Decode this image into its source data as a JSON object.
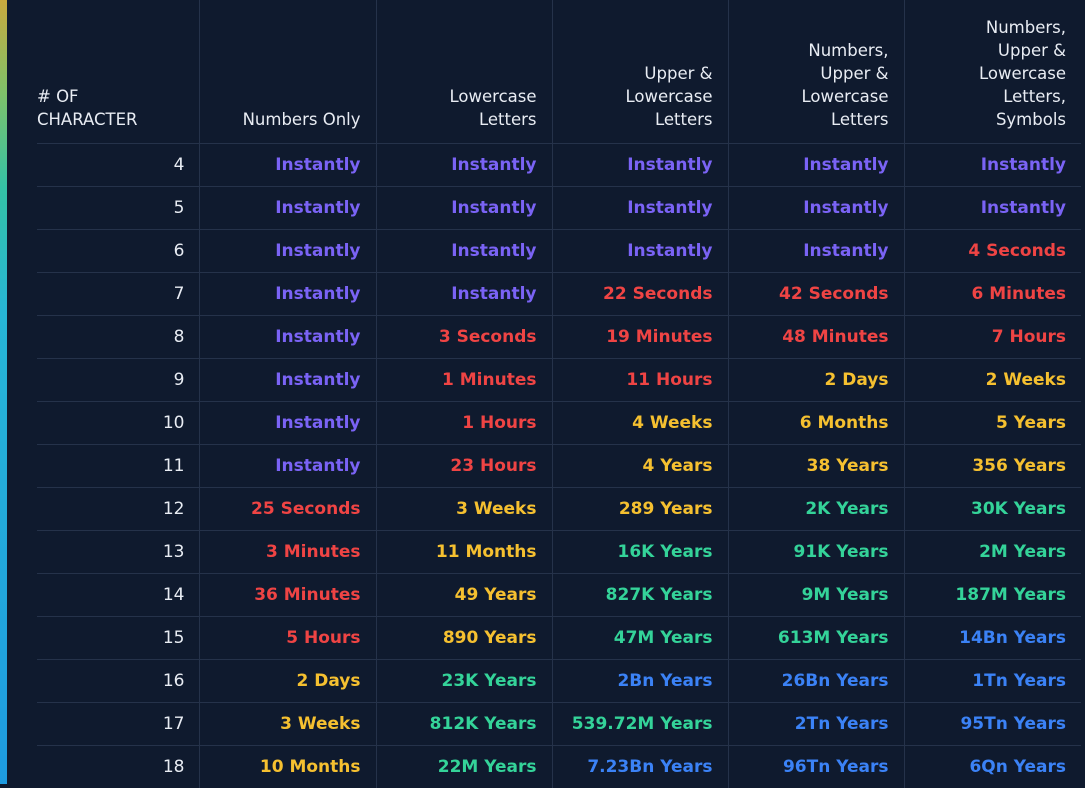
{
  "colors": {
    "background": "#0f1a2e",
    "instantly": "#7a63f5",
    "red": "#ef4444",
    "yellow": "#f5c030",
    "teal": "#34d399",
    "blue": "#3b82f6"
  },
  "table": {
    "headers": [
      "# OF\nCHARACTER",
      "Numbers Only",
      "Lowercase\nLetters",
      "Upper &\nLowercase\nLetters",
      "Numbers,\nUpper &\nLowercase\nLetters",
      "Numbers,\nUpper &\nLowercase\nLetters,\nSymbols"
    ],
    "rows": [
      {
        "chars": "4",
        "cells": [
          {
            "text": "Instantly",
            "level": "instant"
          },
          {
            "text": "Instantly",
            "level": "instant"
          },
          {
            "text": "Instantly",
            "level": "instant"
          },
          {
            "text": "Instantly",
            "level": "instant"
          },
          {
            "text": "Instantly",
            "level": "instant"
          }
        ]
      },
      {
        "chars": "5",
        "cells": [
          {
            "text": "Instantly",
            "level": "instant"
          },
          {
            "text": "Instantly",
            "level": "instant"
          },
          {
            "text": "Instantly",
            "level": "instant"
          },
          {
            "text": "Instantly",
            "level": "instant"
          },
          {
            "text": "Instantly",
            "level": "instant"
          }
        ]
      },
      {
        "chars": "6",
        "cells": [
          {
            "text": "Instantly",
            "level": "instant"
          },
          {
            "text": "Instantly",
            "level": "instant"
          },
          {
            "text": "Instantly",
            "level": "instant"
          },
          {
            "text": "Instantly",
            "level": "instant"
          },
          {
            "text": "4 Seconds",
            "level": "red"
          }
        ]
      },
      {
        "chars": "7",
        "cells": [
          {
            "text": "Instantly",
            "level": "instant"
          },
          {
            "text": "Instantly",
            "level": "instant"
          },
          {
            "text": "22 Seconds",
            "level": "red"
          },
          {
            "text": "42 Seconds",
            "level": "red"
          },
          {
            "text": "6 Minutes",
            "level": "red"
          }
        ]
      },
      {
        "chars": "8",
        "cells": [
          {
            "text": "Instantly",
            "level": "instant"
          },
          {
            "text": "3 Seconds",
            "level": "red"
          },
          {
            "text": "19 Minutes",
            "level": "red"
          },
          {
            "text": "48 Minutes",
            "level": "red"
          },
          {
            "text": "7 Hours",
            "level": "red"
          }
        ]
      },
      {
        "chars": "9",
        "cells": [
          {
            "text": "Instantly",
            "level": "instant"
          },
          {
            "text": "1 Minutes",
            "level": "red"
          },
          {
            "text": "11 Hours",
            "level": "red"
          },
          {
            "text": "2 Days",
            "level": "yellow"
          },
          {
            "text": "2 Weeks",
            "level": "yellow"
          }
        ]
      },
      {
        "chars": "10",
        "cells": [
          {
            "text": "Instantly",
            "level": "instant"
          },
          {
            "text": "1 Hours",
            "level": "red"
          },
          {
            "text": "4 Weeks",
            "level": "yellow"
          },
          {
            "text": "6 Months",
            "level": "yellow"
          },
          {
            "text": "5 Years",
            "level": "yellow"
          }
        ]
      },
      {
        "chars": "11",
        "cells": [
          {
            "text": "Instantly",
            "level": "instant"
          },
          {
            "text": "23 Hours",
            "level": "red"
          },
          {
            "text": "4 Years",
            "level": "yellow"
          },
          {
            "text": "38 Years",
            "level": "yellow"
          },
          {
            "text": "356 Years",
            "level": "yellow"
          }
        ]
      },
      {
        "chars": "12",
        "cells": [
          {
            "text": "25 Seconds",
            "level": "red"
          },
          {
            "text": "3 Weeks",
            "level": "yellow"
          },
          {
            "text": "289 Years",
            "level": "yellow"
          },
          {
            "text": "2K Years",
            "level": "teal"
          },
          {
            "text": "30K Years",
            "level": "teal"
          }
        ]
      },
      {
        "chars": "13",
        "cells": [
          {
            "text": "3 Minutes",
            "level": "red"
          },
          {
            "text": "11 Months",
            "level": "yellow"
          },
          {
            "text": "16K Years",
            "level": "teal"
          },
          {
            "text": "91K Years",
            "level": "teal"
          },
          {
            "text": "2M Years",
            "level": "teal"
          }
        ]
      },
      {
        "chars": "14",
        "cells": [
          {
            "text": "36 Minutes",
            "level": "red"
          },
          {
            "text": "49 Years",
            "level": "yellow"
          },
          {
            "text": "827K Years",
            "level": "teal"
          },
          {
            "text": "9M Years",
            "level": "teal"
          },
          {
            "text": "187M Years",
            "level": "teal"
          }
        ]
      },
      {
        "chars": "15",
        "cells": [
          {
            "text": "5 Hours",
            "level": "red"
          },
          {
            "text": "890 Years",
            "level": "yellow"
          },
          {
            "text": "47M Years",
            "level": "teal"
          },
          {
            "text": "613M Years",
            "level": "teal"
          },
          {
            "text": "14Bn Years",
            "level": "blue"
          }
        ]
      },
      {
        "chars": "16",
        "cells": [
          {
            "text": "2 Days",
            "level": "yellow"
          },
          {
            "text": "23K Years",
            "level": "teal"
          },
          {
            "text": "2Bn Years",
            "level": "blue"
          },
          {
            "text": "26Bn Years",
            "level": "blue"
          },
          {
            "text": "1Tn Years",
            "level": "blue"
          }
        ]
      },
      {
        "chars": "17",
        "cells": [
          {
            "text": "3 Weeks",
            "level": "yellow"
          },
          {
            "text": "812K Years",
            "level": "teal"
          },
          {
            "text": "539.72M Years",
            "level": "teal"
          },
          {
            "text": "2Tn Years",
            "level": "blue"
          },
          {
            "text": "95Tn Years",
            "level": "blue"
          }
        ]
      },
      {
        "chars": "18",
        "cells": [
          {
            "text": "10 Months",
            "level": "yellow"
          },
          {
            "text": "22M Years",
            "level": "teal"
          },
          {
            "text": "7.23Bn Years",
            "level": "blue"
          },
          {
            "text": "96Tn Years",
            "level": "blue"
          },
          {
            "text": "6Qn Years",
            "level": "blue"
          }
        ]
      }
    ]
  }
}
